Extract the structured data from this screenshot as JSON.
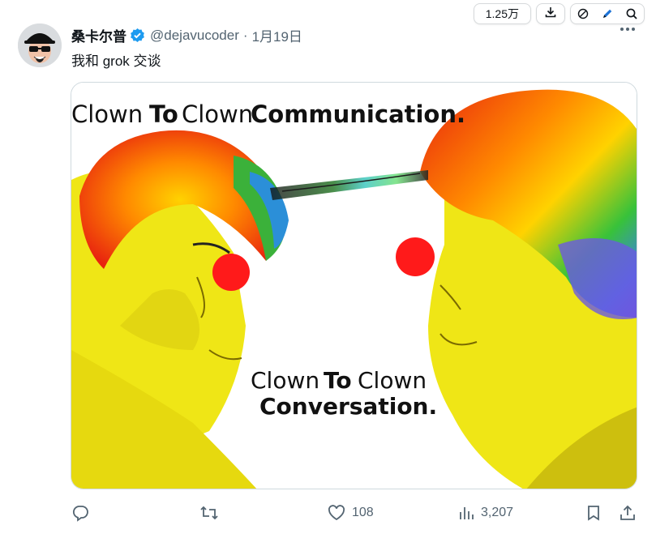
{
  "toolbar": {
    "views_label": "1.25万"
  },
  "tweet": {
    "display_name": "桑卡尔普",
    "handle": "@dejavucoder",
    "separator": "·",
    "date": "1月19日",
    "text": "我和 grok 交谈"
  },
  "media": {
    "caption_top": [
      "Clown",
      "To",
      "Clown",
      "Communication."
    ],
    "caption_bottom_line1": [
      "Clown",
      "To",
      "Clown"
    ],
    "caption_bottom_line2": "Conversation."
  },
  "actions": {
    "likes": "108",
    "views": "3,207"
  },
  "colors": {
    "accent_verified": "#1d9bf0",
    "muted_text": "#536471",
    "clown_nose": "#ff1a1a",
    "skin": "#f2ea1a"
  },
  "icons": [
    "download-icon",
    "slash-circle-icon",
    "pen-icon",
    "search-icon",
    "verified-badge-icon",
    "more-icon",
    "reply-icon",
    "retweet-icon",
    "like-icon",
    "views-icon",
    "bookmark-icon",
    "share-icon"
  ]
}
